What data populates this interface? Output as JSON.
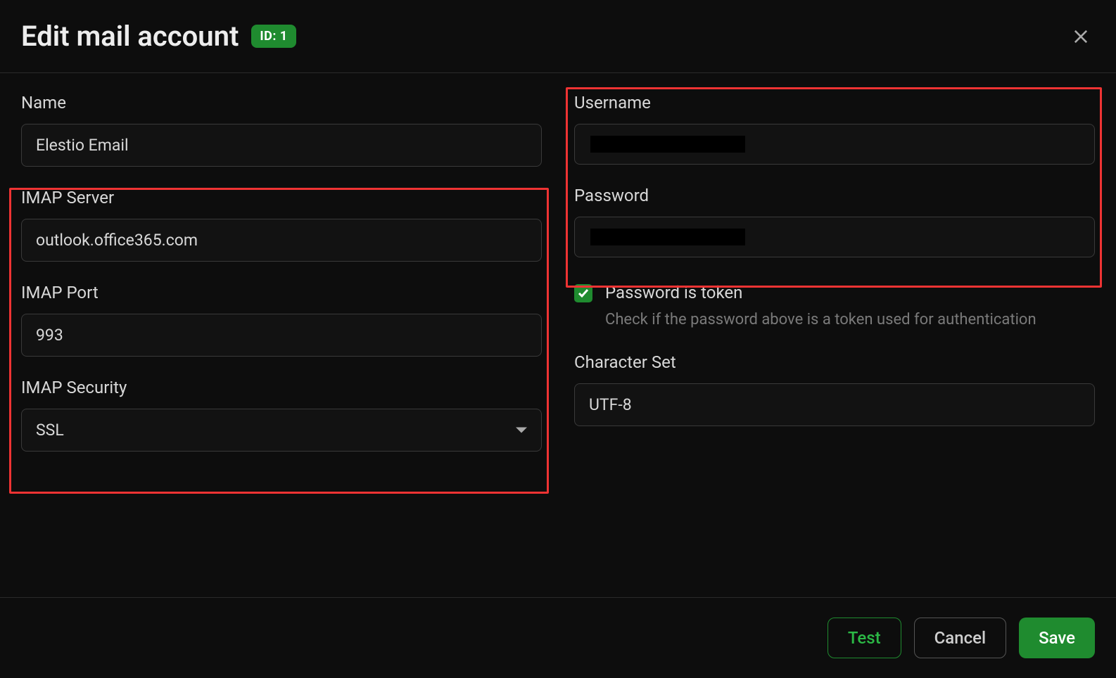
{
  "header": {
    "title": "Edit mail account",
    "id_badge": "ID: 1"
  },
  "left": {
    "name_label": "Name",
    "name_value": "Elestio Email",
    "imap_server_label": "IMAP Server",
    "imap_server_value": "outlook.office365.com",
    "imap_port_label": "IMAP Port",
    "imap_port_value": "993",
    "imap_security_label": "IMAP Security",
    "imap_security_value": "SSL"
  },
  "right": {
    "username_label": "Username",
    "username_value": "",
    "password_label": "Password",
    "password_value": "",
    "password_is_token_label": "Password is token",
    "password_is_token_checked": true,
    "password_is_token_help": "Check if the password above is a token used for authentication",
    "charset_label": "Character Set",
    "charset_value": "UTF-8"
  },
  "footer": {
    "test_label": "Test",
    "cancel_label": "Cancel",
    "save_label": "Save"
  }
}
